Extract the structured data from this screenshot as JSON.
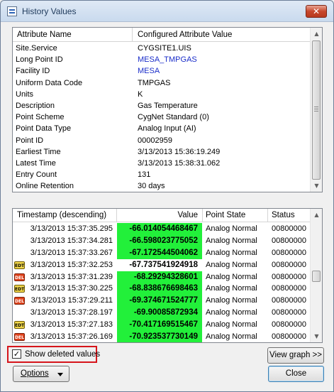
{
  "window": {
    "title": "History Values",
    "close_glyph": "✕"
  },
  "attributes": {
    "headers": {
      "name": "Attribute Name",
      "value": "Configured Attribute Value"
    },
    "rows": [
      {
        "name": "Site.Service",
        "value": "CYGSITE1.UIS",
        "link": false
      },
      {
        "name": "Long Point ID",
        "value": "MESA_TMPGAS",
        "link": true
      },
      {
        "name": "Facility ID",
        "value": "MESA",
        "link": true
      },
      {
        "name": "Uniform Data Code",
        "value": "TMPGAS",
        "link": false
      },
      {
        "name": "Units",
        "value": "K",
        "link": false
      },
      {
        "name": "Description",
        "value": "Gas Temperature",
        "link": false
      },
      {
        "name": "Point Scheme",
        "value": "CygNet Standard (0)",
        "link": false
      },
      {
        "name": "Point Data Type",
        "value": "Analog Input (AI)",
        "link": false
      },
      {
        "name": "Point ID",
        "value": "00002959",
        "link": false
      },
      {
        "name": "Earliest Time",
        "value": "3/13/2013 15:36:19.249",
        "link": false
      },
      {
        "name": "Latest Time",
        "value": "3/13/2013 15:38:31.062",
        "link": false
      },
      {
        "name": "Entry Count",
        "value": "131",
        "link": false
      },
      {
        "name": "Online Retention",
        "value": "30 days",
        "link": false
      }
    ]
  },
  "history": {
    "headers": {
      "timestamp": "Timestamp  (descending)",
      "value": "Value",
      "state": "Point State",
      "status": "Status"
    },
    "colors": {
      "value_highlight": "#22f03a"
    },
    "rows": [
      {
        "badge": "",
        "timestamp": "3/13/2013 15:37:35.295",
        "value": "-66.014054468467",
        "state": "Analog Normal",
        "status": "00800000",
        "highlight": true
      },
      {
        "badge": "",
        "timestamp": "3/13/2013 15:37:34.281",
        "value": "-66.598023775052",
        "state": "Analog Normal",
        "status": "00800000",
        "highlight": true
      },
      {
        "badge": "",
        "timestamp": "3/13/2013 15:37:33.267",
        "value": "-67.172544504062",
        "state": "Analog Normal",
        "status": "00800000",
        "highlight": true
      },
      {
        "badge": "EDT",
        "timestamp": "3/13/2013 15:37:32.253",
        "value": "-67.737541924918",
        "state": "Analog Normal",
        "status": "00800000",
        "highlight": false
      },
      {
        "badge": "DEL",
        "timestamp": "3/13/2013 15:37:31.239",
        "value": "-68.29294328601",
        "state": "Analog Normal",
        "status": "00800000",
        "highlight": true
      },
      {
        "badge": "EDT",
        "timestamp": "3/13/2013 15:37:30.225",
        "value": "-68.838676698463",
        "state": "Analog Normal",
        "status": "00800000",
        "highlight": true
      },
      {
        "badge": "DEL",
        "timestamp": "3/13/2013 15:37:29.211",
        "value": "-69.374671524777",
        "state": "Analog Normal",
        "status": "00800000",
        "highlight": true
      },
      {
        "badge": "",
        "timestamp": "3/13/2013 15:37:28.197",
        "value": "-69.90085872934",
        "state": "Analog Normal",
        "status": "00800000",
        "highlight": true
      },
      {
        "badge": "EDT",
        "timestamp": "3/13/2013 15:37:27.183",
        "value": "-70.417169515467",
        "state": "Analog Normal",
        "status": "00800000",
        "highlight": true
      },
      {
        "badge": "DEL",
        "timestamp": "3/13/2013 15:37:26.169",
        "value": "-70.923537730149",
        "state": "Analog Normal",
        "status": "00800000",
        "highlight": true
      }
    ]
  },
  "controls": {
    "show_deleted_label": "Show deleted values",
    "show_deleted_checked": true,
    "check_glyph": "✓",
    "view_graph_label": "View graph >>",
    "options_label": "Options",
    "close_label": "Close"
  }
}
